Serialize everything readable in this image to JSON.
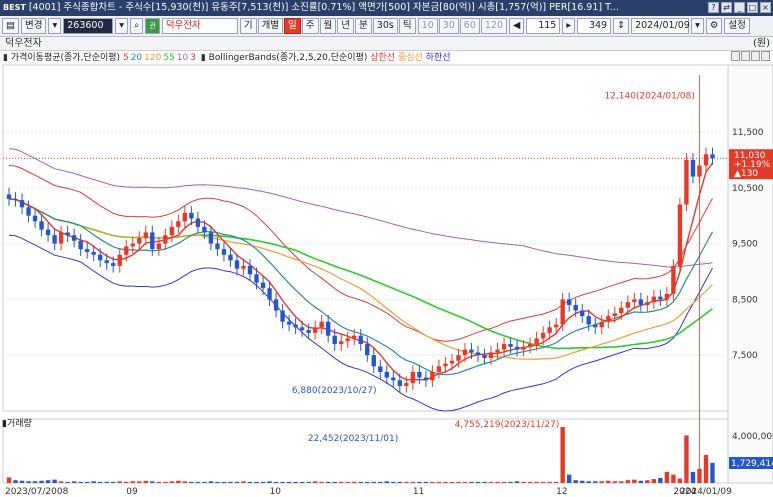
{
  "titlebar": {
    "logo": "BEST",
    "text": "[4001] 주식종합차트 - 주식수[15,930(천)] 유동주[7,513(천)] 소진률[0.71%] 액면가[500] 자본금[80(억)] 시총[1,757(억)] PER[16.91] T..."
  },
  "toolbar": {
    "change": "변경",
    "code": "263600",
    "name": "덕우전자",
    "periods": [
      "기",
      "개별",
      "일",
      "주",
      "월",
      "년",
      "분",
      "30s",
      "틱"
    ],
    "active_period": "일",
    "intervals": [
      "10",
      "30",
      "60",
      "120"
    ],
    "count": "115",
    "total": "349",
    "date": "2024/01/09",
    "settings": "설정"
  },
  "stock_name": "덕우전자",
  "unit": "(원)",
  "legend": {
    "ma_label": "가격이동평균(종가,단순이평)",
    "ma_periods": [
      "5",
      "20",
      "120",
      "55",
      "10",
      "3"
    ],
    "bb_label": "BollingerBands(종가,2,5,20,단순이평)",
    "bb_upper": "상한선",
    "bb_mid": "중심선",
    "bb_lower": "하한선"
  },
  "volume_label": "거래량",
  "colors": {
    "up": "#e23b2a",
    "down": "#2657c9",
    "ma5": "#e23b2a",
    "ma20": "#2d8e8e",
    "ma120": "#f39a3c",
    "ma55": "#2dcc2d",
    "ma10": "#a061b8",
    "bb_up": "#d93d3d",
    "bb_low": "#3535d0",
    "accent": "#2a3f6a"
  },
  "chart_data": {
    "type": "candlestick",
    "y_axis_ticks": [
      "11,500",
      "10,500",
      "9,500",
      "8,500",
      "7,500"
    ],
    "y_axis_values": [
      11500,
      10500,
      9500,
      8500,
      7500
    ],
    "ylim": [
      6500,
      12700
    ],
    "x_axis_labels": [
      "2023/07/2008",
      "09",
      "10",
      "11",
      "12",
      "2024",
      "2024/01/09"
    ],
    "current_price": "11,030",
    "change_percent": "+1.19%",
    "change_arrow": "▲130",
    "annotations": {
      "high": "12,140(2024/01/08)",
      "low": "6,880(2023/10/27)",
      "vol_high": "4,755,219(2023/11/27)",
      "vol_low": "22,452(2023/11/01)"
    },
    "closes": [
      10300,
      10280,
      10150,
      10000,
      9900,
      9750,
      9650,
      9500,
      9700,
      9650,
      9550,
      9400,
      9350,
      9300,
      9200,
      9150,
      9100,
      9300,
      9450,
      9500,
      9600,
      9700,
      9400,
      9500,
      9650,
      9800,
      9900,
      10050,
      9950,
      9800,
      9700,
      9500,
      9400,
      9300,
      9200,
      9050,
      9100,
      8950,
      8800,
      8700,
      8500,
      8300,
      8100,
      8050,
      8000,
      7950,
      7900,
      8000,
      8100,
      7850,
      7700,
      7750,
      7800,
      7850,
      7700,
      7500,
      7300,
      7200,
      7100,
      7050,
      6950,
      7000,
      7200,
      7100,
      7050,
      7200,
      7300,
      7350,
      7400,
      7500,
      7600,
      7550,
      7500,
      7450,
      7550,
      7600,
      7700,
      7650,
      7600,
      7650,
      7700,
      7800,
      7900,
      8000,
      8050,
      8500,
      8400,
      8300,
      8200,
      8050,
      8000,
      8100,
      8200,
      8250,
      8350,
      8450,
      8500,
      8400,
      8450,
      8550,
      8500,
      8600,
      9100,
      10200,
      11000,
      10700,
      10900,
      11100,
      11030
    ],
    "volume_y_tick": "4,000,000",
    "volume_current": "1,729,414",
    "volumes": [
      0.1,
      0.05,
      0.04,
      0.03,
      0.03,
      0.04,
      0.05,
      0.06,
      0.03,
      0.02,
      0.03,
      0.02,
      0.02,
      0.03,
      0.02,
      0.02,
      0.02,
      0.03,
      0.02,
      0.03,
      0.03,
      0.04,
      0.03,
      0.02,
      0.02,
      0.03,
      0.04,
      0.03,
      0.02,
      0.02,
      0.02,
      0.03,
      0.02,
      0.02,
      0.02,
      0.02,
      0.03,
      0.02,
      0.02,
      0.02,
      0.03,
      0.02,
      0.02,
      0.02,
      0.02,
      0.02,
      0.02,
      0.03,
      0.02,
      0.02,
      0.02,
      0.02,
      0.02,
      0.02,
      0.02,
      0.02,
      0.02,
      0.02,
      0.03,
      0.02,
      0.02,
      0.02,
      0.02,
      0.02,
      0.02,
      0.02,
      0.02,
      0.02,
      0.02,
      0.02,
      0.02,
      0.02,
      0.02,
      0.02,
      0.02,
      0.02,
      0.02,
      0.02,
      0.03,
      0.02,
      0.02,
      0.02,
      0.02,
      0.02,
      0.02,
      1.0,
      0.15,
      0.05,
      0.04,
      0.03,
      0.03,
      0.03,
      0.04,
      0.03,
      0.03,
      0.05,
      0.06,
      0.04,
      0.05,
      0.07,
      0.09,
      0.2,
      0.15,
      0.08,
      0.85,
      0.2,
      0.25,
      0.5,
      0.36
    ]
  }
}
